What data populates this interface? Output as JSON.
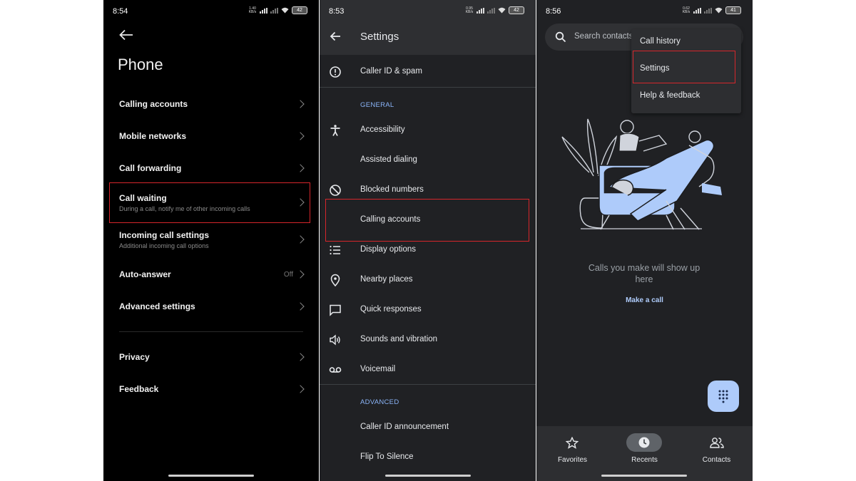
{
  "panel_left": {
    "status": {
      "time": "8:54",
      "speed": "1.40 KB/s",
      "battery": "42"
    },
    "title": "Phone",
    "items": [
      {
        "label": "Calling accounts",
        "sub": "",
        "value": ""
      },
      {
        "label": "Mobile networks",
        "sub": "",
        "value": ""
      },
      {
        "label": "Call forwarding",
        "sub": "",
        "value": ""
      },
      {
        "label": "Call waiting",
        "sub": "During a call, notify me of other incoming calls",
        "value": ""
      },
      {
        "label": "Incoming call settings",
        "sub": "Additional incoming call options",
        "value": ""
      },
      {
        "label": "Auto-answer",
        "sub": "",
        "value": "Off"
      },
      {
        "label": "Advanced settings",
        "sub": "",
        "value": ""
      },
      {
        "label": "Privacy",
        "sub": "",
        "value": ""
      },
      {
        "label": "Feedback",
        "sub": "",
        "value": ""
      }
    ]
  },
  "panel_middle": {
    "status": {
      "time": "8:53",
      "speed": "0.95 KB/s",
      "battery": "42"
    },
    "title": "Settings",
    "top_item": "Caller ID & spam",
    "general_label": "GENERAL",
    "general_items": [
      {
        "label": "Accessibility",
        "icon": "accessibility-icon"
      },
      {
        "label": "Assisted dialing",
        "icon": ""
      },
      {
        "label": "Blocked numbers",
        "icon": "block-icon"
      },
      {
        "label": "Calling accounts",
        "icon": ""
      },
      {
        "label": "Display options",
        "icon": "list-icon"
      },
      {
        "label": "Nearby places",
        "icon": "location-pin-icon"
      },
      {
        "label": "Quick responses",
        "icon": "message-icon"
      },
      {
        "label": "Sounds and vibration",
        "icon": "speaker-icon"
      },
      {
        "label": "Voicemail",
        "icon": "voicemail-icon"
      }
    ],
    "advanced_label": "ADVANCED",
    "advanced_items": [
      {
        "label": "Caller ID announcement"
      },
      {
        "label": "Flip To Silence"
      }
    ]
  },
  "panel_right": {
    "status": {
      "time": "8:56",
      "speed": "0.62 KB/s",
      "battery": "41"
    },
    "search_placeholder": "Search contacts",
    "menu": [
      "Call history",
      "Settings",
      "Help & feedback"
    ],
    "empty_text": "Calls you make will show up here",
    "make_call": "Make a call",
    "nav": [
      {
        "label": "Favorites",
        "icon": "star-icon"
      },
      {
        "label": "Recents",
        "icon": "clock-icon"
      },
      {
        "label": "Contacts",
        "icon": "people-icon"
      }
    ]
  },
  "colors": {
    "highlight": "#d6262b",
    "accent": "#8ab4f8",
    "dialpad_bg": "#aecbfa"
  }
}
